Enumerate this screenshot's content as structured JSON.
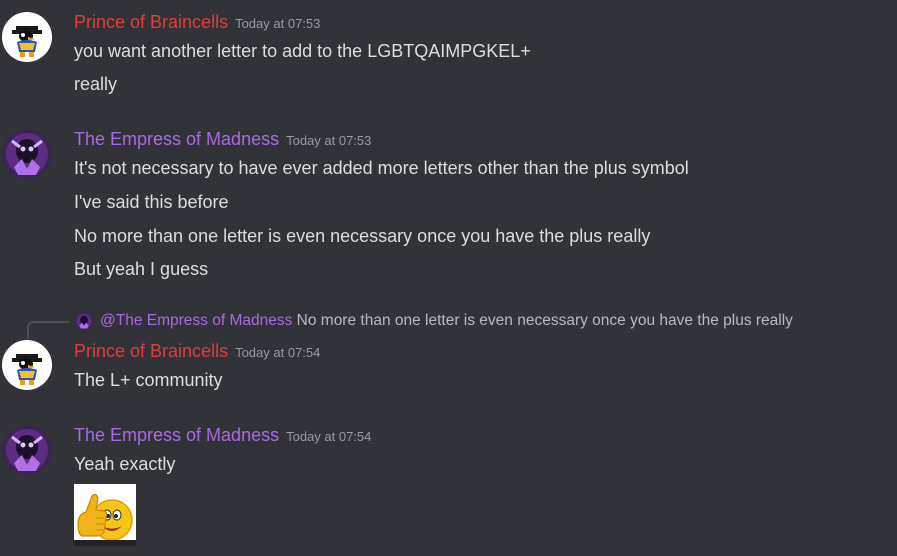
{
  "colors": {
    "background": "#313338",
    "user_prince": "#e03c3c",
    "user_empress": "#a86ae0",
    "text": "#dbdee1",
    "timestamp": "#949ba4"
  },
  "messages": [
    {
      "author": "Prince of Braincells",
      "timestamp": "Today at 07:53",
      "lines": [
        "you want another letter to add to the LGBTQAIMPGKEL+",
        "really"
      ]
    },
    {
      "author": "The Empress of Madness",
      "timestamp": "Today at 07:53",
      "lines": [
        "It's not necessary to have ever added more letters other than the plus symbol",
        "I've said this before",
        "No more than one letter is even necessary once you have the plus really",
        "But yeah I guess"
      ]
    },
    {
      "reply": {
        "mention": "@The Empress of Madness",
        "snippet": "No more than one letter is even necessary once you have the plus really"
      },
      "author": "Prince of Braincells",
      "timestamp": "Today at 07:54",
      "lines": [
        "The L+ community"
      ]
    },
    {
      "author": "The Empress of Madness",
      "timestamp": "Today at 07:54",
      "lines": [
        "Yeah exactly"
      ],
      "attachment_icon": "thumbs-up-smiley-icon"
    }
  ]
}
